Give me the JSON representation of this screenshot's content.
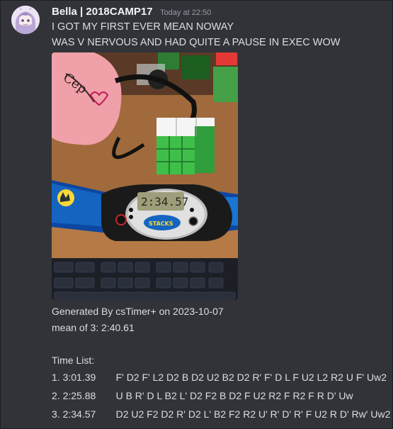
{
  "message": {
    "username": "Bella | 2018CAMP17",
    "timestamp": "Today at 22:50",
    "lines": [
      "I GOT MY FIRST EVER MEAN NOWAY",
      "WAS V NERVOUS AND HAD QUITE A PAUSE IN EXEC WOW"
    ]
  },
  "photo": {
    "timer_display": "2:34.57",
    "timer_brand": "STACKS",
    "mask_text": "Cep",
    "description_icon": "rubiks-cube-photo"
  },
  "result": {
    "generated_line": "Generated By csTimer+ on 2023-10-07",
    "mean_line": "mean of 3: 2:40.61",
    "time_list_label": "Time List:",
    "times": [
      {
        "index": "1.",
        "time": "3:01.39",
        "scramble": "F' D2 F' L2 D2 B D2 U2 B2 D2 R' F' D L F U2 L2 R2 U F' Uw2"
      },
      {
        "index": "2.",
        "time": "2:25.88",
        "scramble": "U B R' D L B2 L' D2 F2 B D2 F U2 R2 F R2 F R D' Uw"
      },
      {
        "index": "3.",
        "time": "2:34.57",
        "scramble": "D2 U2 F2 D2 R' D2 L' B2 F2 R2 U' R' D' R' F U2 R D' Rw' Uw2"
      }
    ]
  },
  "colors": {
    "background": "#313338",
    "text": "#dbdee1",
    "username": "#f2f3f5",
    "muted": "#949ba4"
  }
}
